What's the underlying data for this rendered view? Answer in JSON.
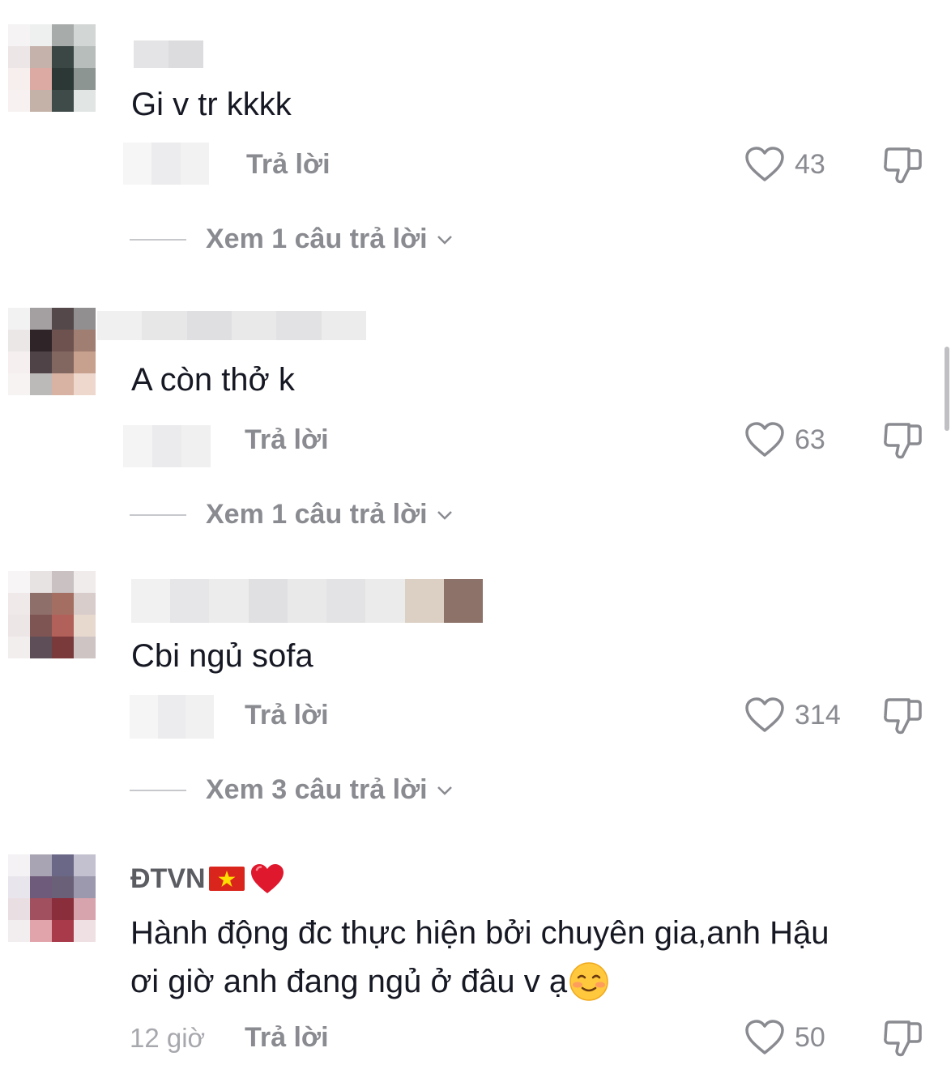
{
  "comments": [
    {
      "text": "Gi v tr kkkk",
      "reply_label": "Trả lời",
      "likes": "43",
      "view_replies": "Xem 1 câu trả lời"
    },
    {
      "text": "A còn thở k",
      "reply_label": "Trả lời",
      "likes": "63",
      "view_replies": "Xem 1 câu trả lời"
    },
    {
      "text": "Cbi ngủ sofa",
      "reply_label": "Trả lời",
      "likes": "314",
      "view_replies": "Xem 3 câu trả lời"
    },
    {
      "username": "ĐTVN",
      "username_emoji": [
        "vietnam-flag",
        "red-heart"
      ],
      "text_line1": "Hành động đc thực hiện bởi chuyên gia,anh Hậu",
      "text_line2": "ơi giờ anh đang ngủ ở đâu v ạ",
      "text_emoji": "smiling-face",
      "time": "12 giờ",
      "reply_label": "Trả lời",
      "likes": "50"
    }
  ],
  "colors": {
    "text": "#161823",
    "secondary": "#8a8b91",
    "background": "#ffffff"
  },
  "icons": [
    "heart-icon",
    "dislike-icon",
    "chevron-down-icon"
  ]
}
